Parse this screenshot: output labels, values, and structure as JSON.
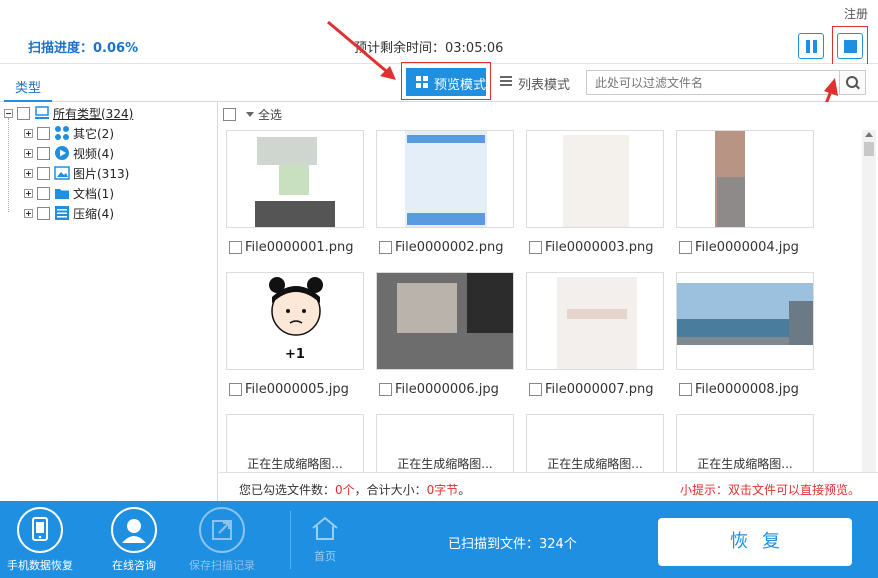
{
  "header": {
    "register": "注册",
    "progress_label": "扫描进度：0.06%",
    "remaining_label": "预计剩余时间：03:05:06"
  },
  "toolbar": {
    "type_tab": "类型",
    "preview_mode": "预览模式",
    "list_mode": "列表模式",
    "filter_placeholder": "此处可以过滤文件名"
  },
  "tree": {
    "root": "所有类型(324)",
    "items": [
      {
        "label": "其它(2)",
        "icon": "apps-icon"
      },
      {
        "label": "视频(4)",
        "icon": "video-icon"
      },
      {
        "label": "图片(313)",
        "icon": "image-icon"
      },
      {
        "label": "文档(1)",
        "icon": "folder-icon"
      },
      {
        "label": "压缩(4)",
        "icon": "archive-icon"
      }
    ]
  },
  "grid": {
    "select_all": "全选",
    "files": [
      {
        "name": "File0000001.png"
      },
      {
        "name": "File0000002.png"
      },
      {
        "name": "File0000003.png"
      },
      {
        "name": "File0000004.jpg"
      },
      {
        "name": "File0000005.jpg",
        "caption": "+1"
      },
      {
        "name": "File0000006.jpg"
      },
      {
        "name": "File0000007.png"
      },
      {
        "name": "File0000008.jpg"
      }
    ],
    "generating": "正在生成缩略图..."
  },
  "status": {
    "selected_prefix": "您已勾选文件数：",
    "selected_count": "0个",
    "size_prefix": "，合计大小：",
    "size_value": "0字节",
    "size_suffix": "。",
    "tip": "小提示：双击文件可以直接预览。"
  },
  "bottom": {
    "phone_recover": "手机数据恢复",
    "online_consult": "在线咨询",
    "save_record": "保存扫描记录",
    "home": "首页",
    "scanned": "已扫描到文件：324个",
    "restore": "恢复"
  },
  "colors": {
    "accent": "#1e8fe1",
    "highlight": "#e03030"
  }
}
